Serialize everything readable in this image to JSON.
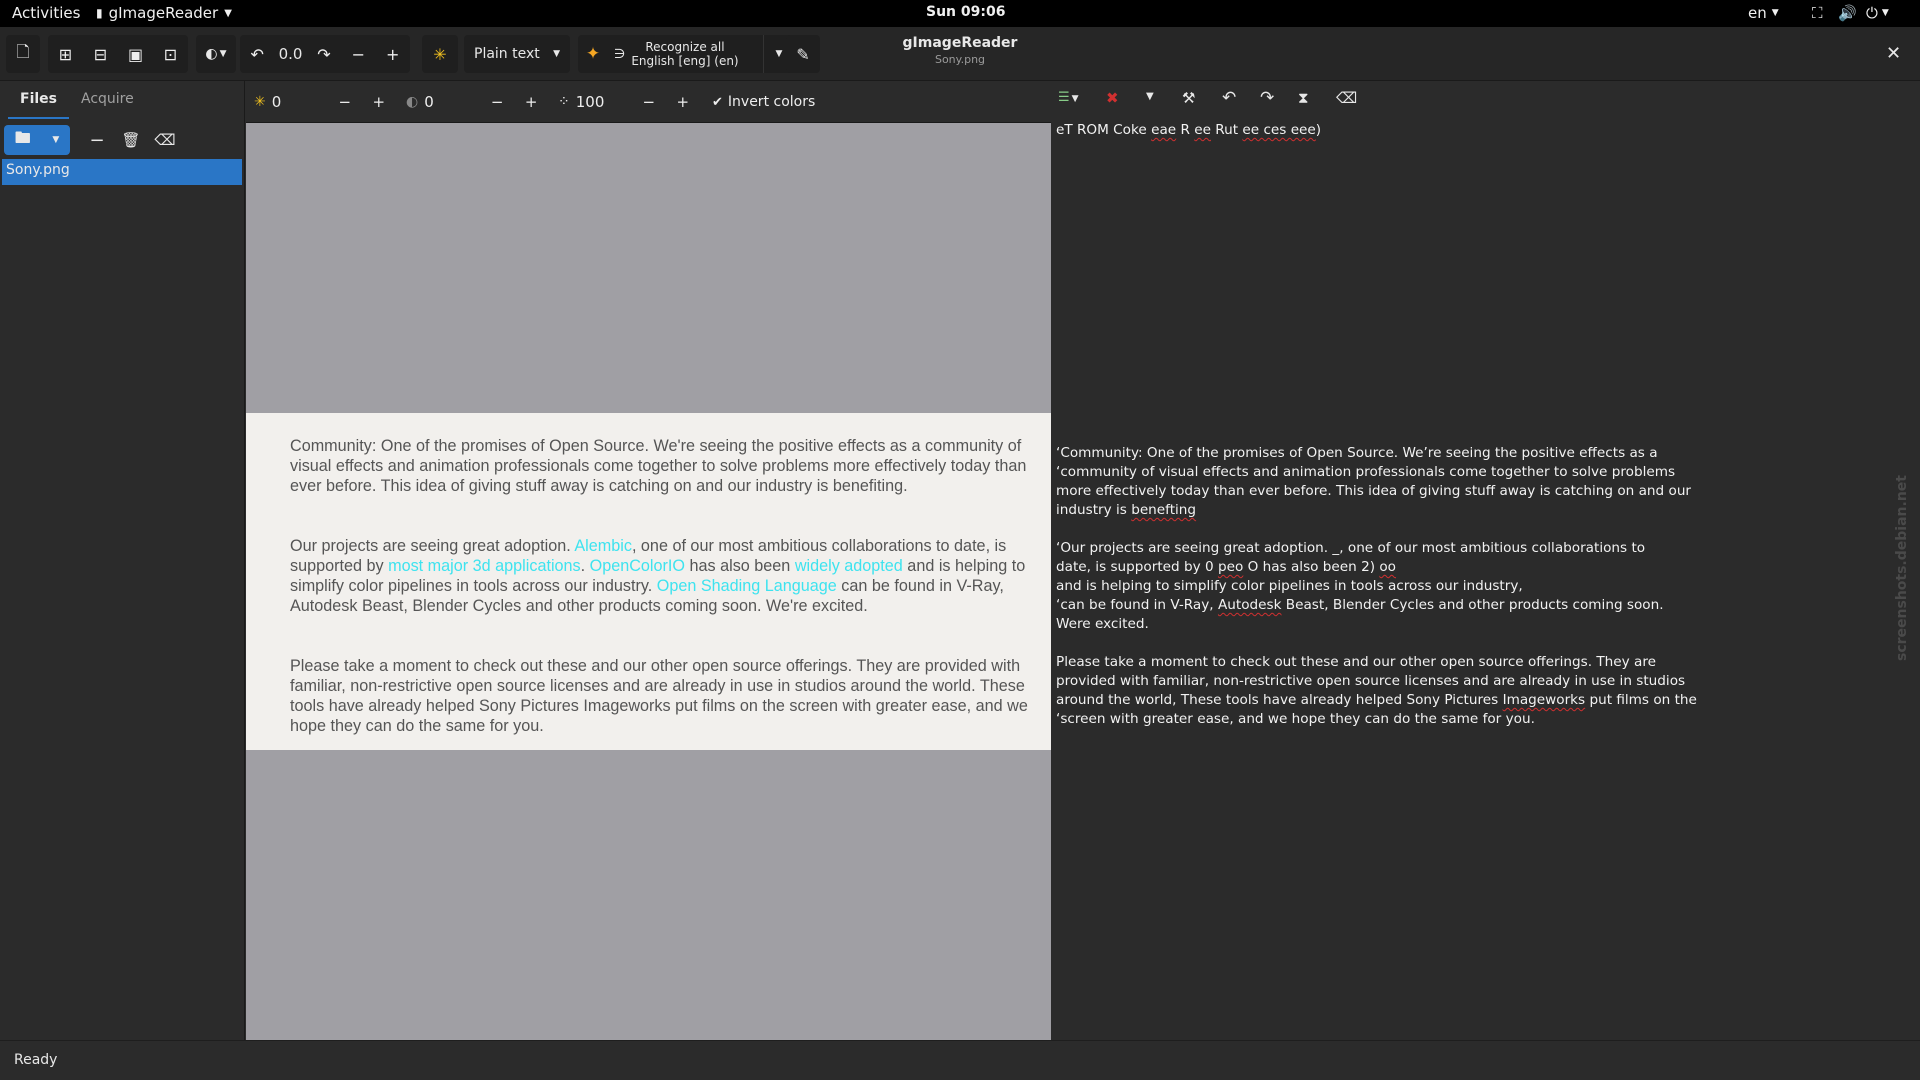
{
  "topbar": {
    "activities": "Activities",
    "app_menu": "gImageReader",
    "clock": "Sun 09:06",
    "lang": "en"
  },
  "header": {
    "title": "gImageReader",
    "subtitle": "Sony.png",
    "rotation_value": "0.0",
    "output_mode": "Plain text",
    "recognize_label": "Recognize all",
    "recognize_lang": "English [eng] (en)"
  },
  "left": {
    "tab_files": "Files",
    "tab_acquire": "Acquire",
    "files": [
      "Sony.png"
    ]
  },
  "image_toolbar": {
    "brightness": "0",
    "contrast": "0",
    "resolution": "100",
    "invert_label": "Invert colors"
  },
  "doc": {
    "p1": "Community: One of the promises of Open Source. We're seeing the positive effects as a community of visual effects and animation professionals come together to solve problems more effectively today than ever before. This idea of giving stuff away is catching on and our industry is benefiting.",
    "p2_a": "Our projects are seeing great adoption. ",
    "p2_link1": "Alembic",
    "p2_b": ", one of our most ambitious collaborations to date, is supported by ",
    "p2_link2": "most major 3d applications",
    "p2_c": ". ",
    "p2_link3": "OpenColorIO",
    "p2_d": " has also been ",
    "p2_link4": "widely adopted",
    "p2_e": " and is helping to simplify color pipelines in tools across our industry. ",
    "p2_link5": "Open Shading Language",
    "p2_f": " can be found in V-Ray, Autodesk Beast, Blender Cycles and other products coming soon. We're excited.",
    "p3": "Please take a moment to check out these and our other open source offerings. They are provided with familiar, non-restrictive open source licenses and are already in use in studios around the world. These tools have already helped Sony Pictures Imageworks put films on the screen with greater ease, and we hope they can do the same for you."
  },
  "ocr": {
    "l0a": "eT ROM Coke ",
    "l0b": "eae",
    "l0c": " R ",
    "l0d": "ee",
    "l0e": " Rut ",
    "l0f": "ee ces eee",
    "l0g": ")",
    "l1": "‘Community: One of the promises of Open Source. We’re seeing the positive effects as a",
    "l2": "‘community of visual effects and animation professionals come together to solve problems",
    "l3": "more effectively today than ever before. This idea of giving stuff away is catching on and our",
    "l4a": "industry is ",
    "l4b": "benefting",
    "l5": "‘Our projects are seeing great adoption. _, one of our most ambitious collaborations to",
    "l6a": "date, is supported by 0 ",
    "l6b": "peo",
    "l6c": " O has also been 2) ",
    "l6d": "oo",
    "l7": "and is helping to simplify color pipelines in tools across our industry,",
    "l8a": "‘can be found in V-Ray, ",
    "l8b": "Autodesk",
    "l8c": " Beast, Blender Cycles and other products coming soon.",
    "l9": "Were excited.",
    "l10": "Please take a moment to check out these and our other open source offerings. They are",
    "l11": "provided with familiar, non-restrictive open source licenses and are already in use in studios",
    "l12a": "around the world, These tools have already helped Sony Pictures ",
    "l12b": "Imageworks",
    "l12c": " put films on the",
    "l13": "‘screen with greater ease, and we hope they can do the same for you."
  },
  "watermark": "screenshots.debian.net",
  "status": "Ready",
  "colors": {
    "accent": "#2a76c6",
    "link": "#3ee3ef",
    "spell": "#d03030"
  }
}
